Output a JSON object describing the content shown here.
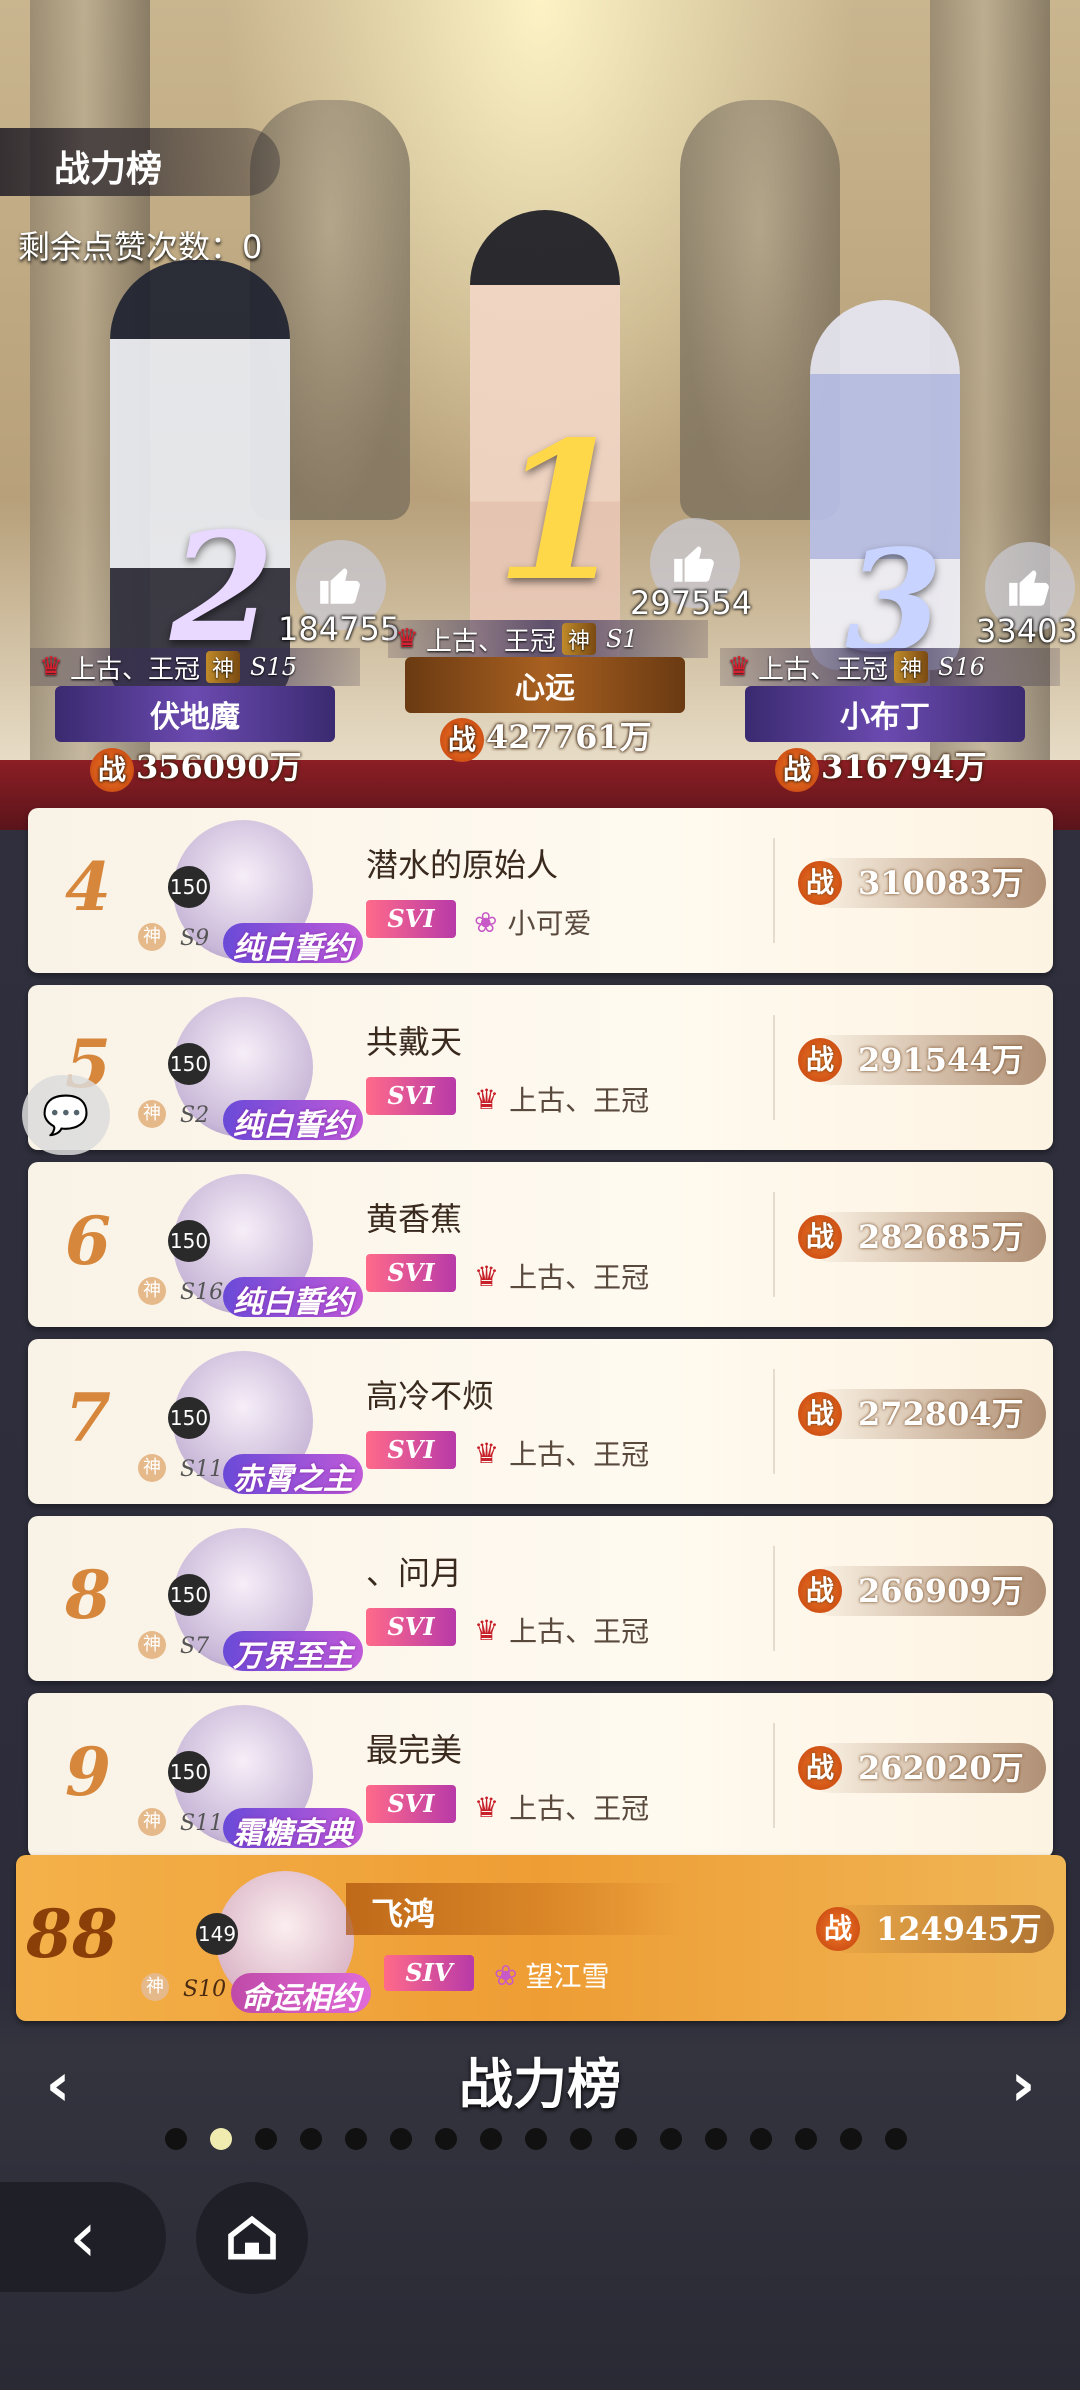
{
  "header": {
    "title": "战力榜",
    "likes_label": "剩余点赞次数：0"
  },
  "podium": [
    {
      "rank": "2",
      "like_count": "184755",
      "guild": "上古、王冠",
      "god": "神",
      "server": "S15",
      "name": "伏地魔",
      "power": "356090万"
    },
    {
      "rank": "1",
      "like_count": "297554",
      "guild": "上古、王冠",
      "god": "神",
      "server": "S1",
      "name": "心远",
      "power": "427761万"
    },
    {
      "rank": "3",
      "like_count": "33403",
      "guild": "上古、王冠",
      "god": "神",
      "server": "S16",
      "name": "小布丁",
      "power": "316794万"
    }
  ],
  "rows": [
    {
      "rank": "4",
      "level": "150",
      "god": "神",
      "server": "S9",
      "frame": "纯白誓约",
      "name": "潜水的原始人",
      "vip": "SVI",
      "guild": "小可爱",
      "power": "310083万"
    },
    {
      "rank": "5",
      "level": "150",
      "god": "神",
      "server": "S2",
      "frame": "纯白誓约",
      "name": "共戴天",
      "vip": "SVI",
      "guild": "上古、王冠",
      "power": "291544万"
    },
    {
      "rank": "6",
      "level": "150",
      "god": "神",
      "server": "S16",
      "frame": "纯白誓约",
      "name": "黄香蕉",
      "vip": "SVI",
      "guild": "上古、王冠",
      "power": "282685万"
    },
    {
      "rank": "7",
      "level": "150",
      "god": "神",
      "server": "S11",
      "frame": "赤霄之主",
      "name": "高冷不烦",
      "vip": "SVI",
      "guild": "上古、王冠",
      "power": "272804万"
    },
    {
      "rank": "8",
      "level": "150",
      "god": "神",
      "server": "S7",
      "frame": "万界至主",
      "name": "、问月",
      "vip": "SVI",
      "guild": "上古、王冠",
      "power": "266909万"
    },
    {
      "rank": "9",
      "level": "150",
      "god": "神",
      "server": "S11",
      "frame": "霜糖奇典",
      "name": "最完美",
      "vip": "SVI",
      "guild": "上古、王冠",
      "power": "262020万"
    }
  ],
  "me": {
    "rank": "88",
    "level": "149",
    "god": "神",
    "server": "S10",
    "frame": "命运相约",
    "name": "飞鸿",
    "vip": "SIV",
    "guild": "望江雪",
    "power": "124945万"
  },
  "zhan": "战",
  "footer": {
    "title": "战力榜",
    "page_count": 17,
    "active_page": 2,
    "prev": "‹",
    "next": "›",
    "back": "‹"
  },
  "colors": {
    "accent": "#ee9d34",
    "rank_text": "#d6873c",
    "power_badge": "#c2400c"
  }
}
